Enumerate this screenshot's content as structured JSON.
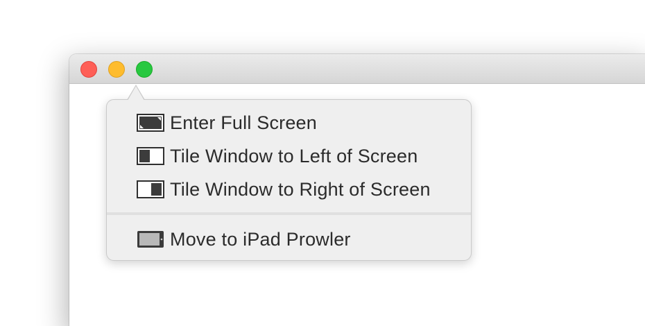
{
  "window": {
    "traffic_lights": {
      "close_color": "#fe5f57",
      "minimize_color": "#febc2e",
      "zoom_color": "#28c840"
    }
  },
  "menu": {
    "items": [
      {
        "label": "Enter Full Screen",
        "icon": "fullscreen-icon"
      },
      {
        "label": "Tile Window to Left of Screen",
        "icon": "tile-left-icon"
      },
      {
        "label": "Tile Window to Right of Screen",
        "icon": "tile-right-icon"
      },
      {
        "label": "Move to iPad Prowler",
        "icon": "ipad-icon"
      }
    ]
  }
}
